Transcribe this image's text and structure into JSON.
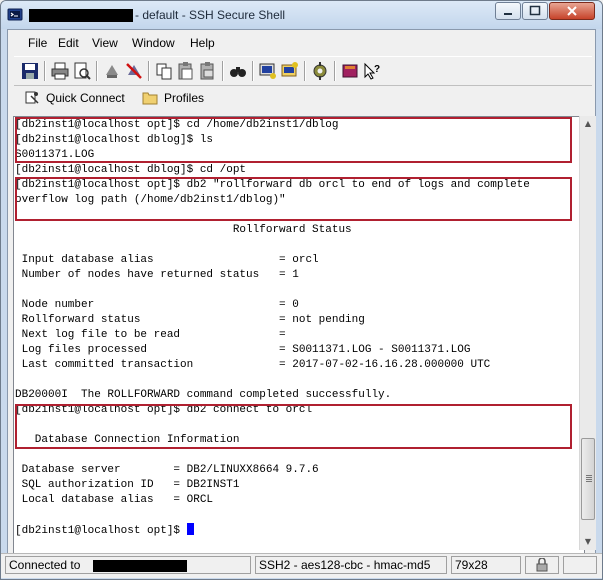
{
  "window": {
    "title": "- default - SSH Secure Shell"
  },
  "menu": {
    "file": "File",
    "edit": "Edit",
    "view": "View",
    "window": "Window",
    "help": "Help"
  },
  "profile_bar": {
    "quick_connect": "Quick Connect",
    "profiles": "Profiles"
  },
  "terminal": {
    "lines": [
      "[db2inst1@localhost opt]$ cd /home/db2inst1/dblog",
      "[db2inst1@localhost dblog]$ ls",
      "S0011371.LOG",
      "[db2inst1@localhost dblog]$ cd /opt",
      "[db2inst1@localhost opt]$ db2 \"rollforward db orcl to end of logs and complete",
      "overflow log path (/home/db2inst1/dblog)\"",
      "",
      "                                 Rollforward Status",
      "",
      " Input database alias                   = orcl",
      " Number of nodes have returned status   = 1",
      "",
      " Node number                            = 0",
      " Rollforward status                     = not pending",
      " Next log file to be read               =",
      " Log files processed                    = S0011371.LOG - S0011371.LOG",
      " Last committed transaction             = 2017-07-02-16.16.28.000000 UTC",
      "",
      "DB20000I  The ROLLFORWARD command completed successfully.",
      "[db2inst1@localhost opt]$ db2 connect to orcl",
      "",
      "   Database Connection Information",
      "",
      " Database server        = DB2/LINUXX8664 9.7.6",
      " SQL authorization ID   = DB2INST1",
      " Local database alias   = ORCL",
      "",
      "[db2inst1@localhost opt]$ "
    ]
  },
  "status": {
    "connected": "Connected to",
    "cipher": "SSH2 - aes128-cbc - hmac-md5",
    "size": "79x28"
  },
  "colors": {
    "highlight_box": "#b02030",
    "cursor": "#0000ff",
    "title_bar": "#c9d9ec"
  }
}
